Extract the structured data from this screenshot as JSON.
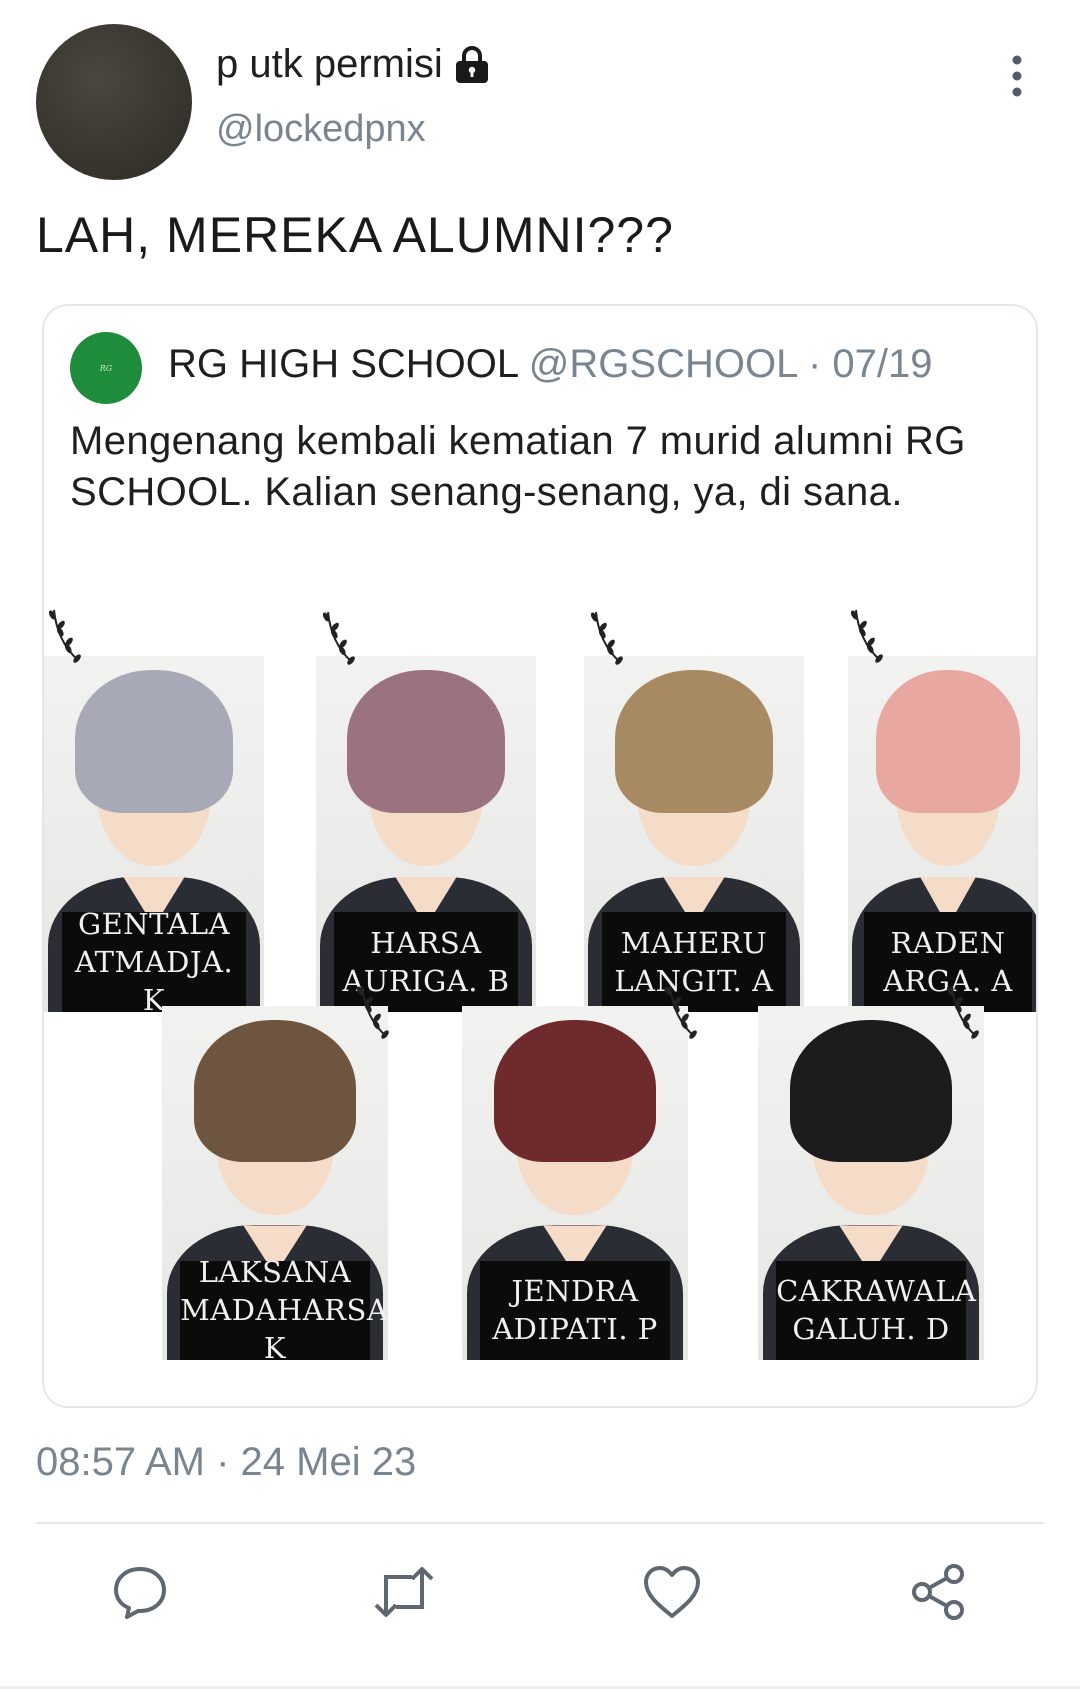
{
  "author": {
    "display_name": "p utk permisi",
    "handle": "@lockedpnx",
    "icons": {
      "locked": "lock-icon",
      "more": "more-vertical-icon"
    }
  },
  "tweet": {
    "text": "LAH, MEREKA ALUMNI???",
    "timestamp": "08:57 AM · 24 Mei 23"
  },
  "quoted": {
    "name": "RG HIGH SCHOOL",
    "handle": "@RGSCHOOL",
    "separator": "·",
    "date": "07/19",
    "text": "Mengenang kembali kematian 7 murid alumni RG SCHOOL. Kalian senang-senang, ya, di sana.",
    "photos": [
      {
        "line1": "GENTALA",
        "line2": "ATMADJA. K",
        "hair": "#a7a9b6"
      },
      {
        "line1": "HARSA",
        "line2": "AURIGA. B",
        "hair": "#9a7280"
      },
      {
        "line1": "MAHERU",
        "line2": "LANGIT. A",
        "hair": "#a88a62"
      },
      {
        "line1": "RADEN",
        "line2": "ARGA. A",
        "hair": "#e8a7a0"
      },
      {
        "line1": "LAKSANA",
        "line2": "MADAHARSA. K",
        "hair": "#6d5540"
      },
      {
        "line1": "JENDRA",
        "line2": "ADIPATI. P",
        "hair": "#6e2a2c"
      },
      {
        "line1": "CAKRAWALA",
        "line2": "GALUH. D",
        "hair": "#1c1b1e"
      }
    ]
  },
  "actions": [
    {
      "name": "reply-icon"
    },
    {
      "name": "retweet-icon"
    },
    {
      "name": "like-icon"
    },
    {
      "name": "share-icon"
    }
  ],
  "colors": {
    "muted": "#7b8590",
    "text": "#1f1f1f",
    "border": "#e3e7eb",
    "school_green": "#1e8c3a"
  }
}
